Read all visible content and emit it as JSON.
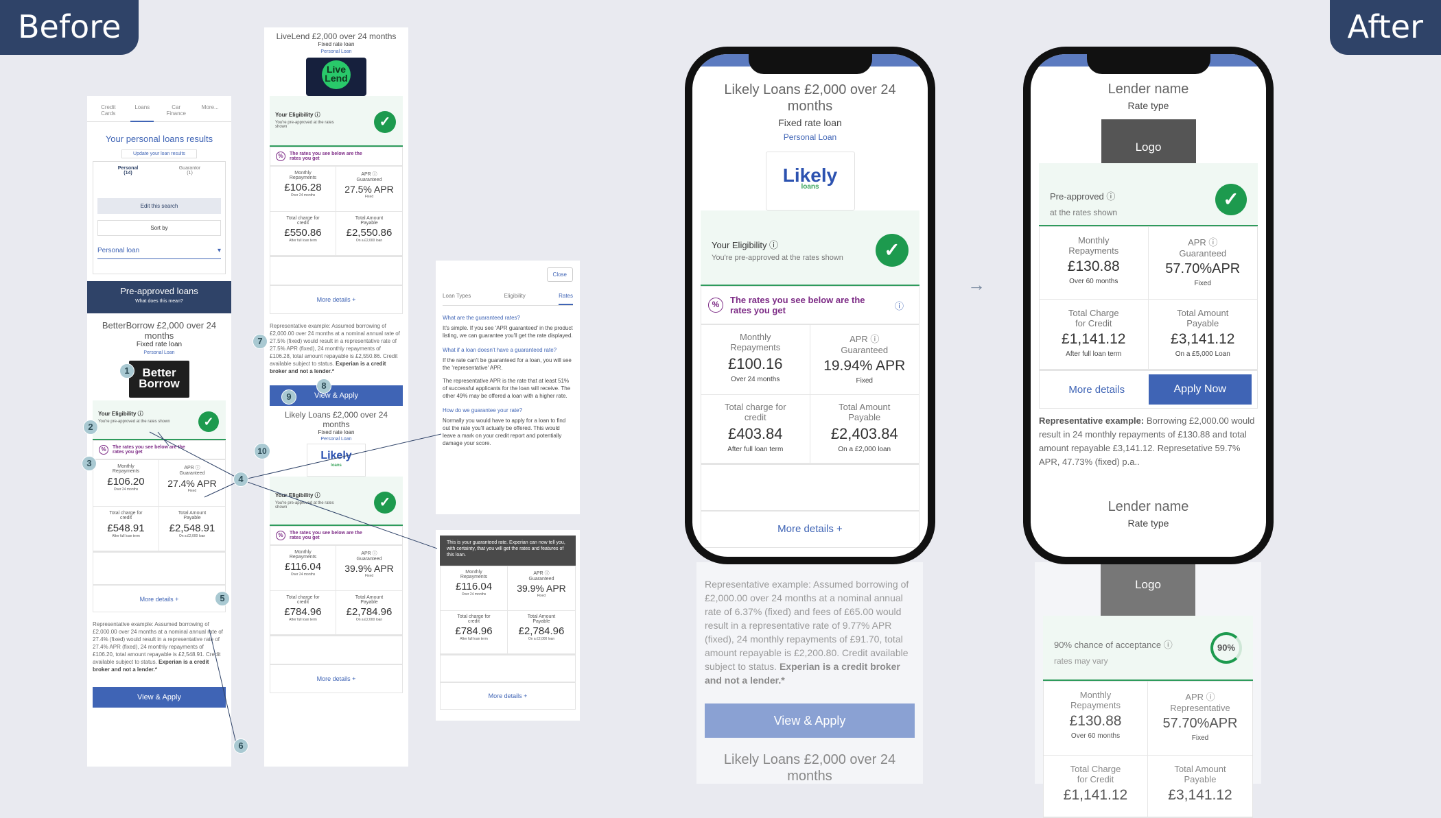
{
  "labels": {
    "before": "Before",
    "after": "After"
  },
  "colors": {
    "accent": "#3f64b5",
    "navy": "#2f4368",
    "green": "#1d9a4e",
    "purple": "#7c2a85",
    "annot": "#a9c9d2"
  },
  "p1": {
    "tabs": [
      "Credit Cards",
      "Loans",
      "Car Finance",
      "More..."
    ],
    "results_title": "Your personal loans results",
    "update_link": "Update your loan results",
    "filter": [
      {
        "label": "Personal",
        "count": "(14)"
      },
      {
        "label": "Guarantor",
        "count": "(1)"
      }
    ],
    "edit_search": "Edit this search",
    "sort_by": "Sort by",
    "loan_type": "Personal loan",
    "banner_title": "Pre-approved loans",
    "banner_sub": "What does this mean?",
    "offer_title": "BetterBorrow £2,000 over 24 months",
    "rate_type": "Fixed rate loan",
    "loan_link": "Personal Loan",
    "logo_text": "Better Borrow",
    "elig_title": "Your Eligibility ⓘ",
    "elig_sub": "You're pre-approved at the rates shown",
    "rates_note": "The rates you see below are the rates you get",
    "cells": [
      {
        "label": "Monthly Repayments",
        "value": "£106.20",
        "sub": "Over 24 months"
      },
      {
        "label": "APR ⓘ Guaranteed",
        "value": "27.4% APR",
        "sub": "Fixed"
      },
      {
        "label": "Total charge for credit",
        "value": "£548.91",
        "sub": "After full loan term"
      },
      {
        "label": "Total Amount Payable",
        "value": "£2,548.91",
        "sub": "On a £2,000 loan"
      }
    ],
    "more": "More details +",
    "rep": "Representative example: Assumed borrowing of £2,000.00 over 24 months at a nominal annual rate of 27.4% (fixed) would result in a representative rate of 27.4% APR (fixed), 24 monthly repayments of £106.20, total amount repayable is £2,548.91. Credit available subject to status.",
    "rep_bold": "Experian is a credit broker and not a lender.*",
    "apply": "View & Apply"
  },
  "p2": {
    "title": "LiveLend £2,000 over 24 months",
    "rate_type": "Fixed rate loan",
    "loan_link": "Personal Loan",
    "logo_text": "Live Lend",
    "elig_title": "Your Eligibility ⓘ",
    "elig_sub": "You're pre-approved at the rates shown",
    "rates_note": "The rates you see below are the rates you get",
    "cells": [
      {
        "label": "Monthly Repayments",
        "value": "£106.28",
        "sub": "Over 24 months"
      },
      {
        "label": "APR ⓘ Guaranteed",
        "value": "27.5% APR",
        "sub": "Fixed"
      },
      {
        "label": "Total charge for credit",
        "value": "£550.86",
        "sub": "After full loan term"
      },
      {
        "label": "Total Amount Payable",
        "value": "£2,550.86",
        "sub": "On a £2,000 loan"
      }
    ],
    "more": "More details +",
    "rep": "Representative example: Assumed borrowing of £2,000.00 over 24 months at a nominal annual rate of 27.5% (fixed) would result in a representative rate of 27.5% APR (fixed), 24 monthly repayments of £106.28, total amount repayable is £2,550.86. Credit available subject to status.",
    "rep_bold": "Experian is a credit broker and not a lender.*",
    "apply": "View & Apply",
    "title2": "Likely Loans £2,000 over 24 months",
    "rate_type2": "Fixed rate loan",
    "loan_link2": "Personal Loan",
    "logo2": "Likely",
    "logo2_sub": "loans",
    "cells2": [
      {
        "label": "Monthly Repayments",
        "value": "£116.04",
        "sub": "Over 24 months"
      },
      {
        "label": "APR ⓘ Guaranteed",
        "value": "39.9% APR",
        "sub": "Fixed"
      },
      {
        "label": "Total charge for credit",
        "value": "£784.96",
        "sub": "After full loan term"
      },
      {
        "label": "Total Amount Payable",
        "value": "£2,784.96",
        "sub": "On a £2,000 loan"
      }
    ],
    "more2": "More details +"
  },
  "p3": {
    "close": "Close",
    "tabs": [
      "Loan Types",
      "Eligibility",
      "Rates"
    ],
    "q1": "What are the guaranteed rates?",
    "a1": "It's simple. If you see 'APR guaranteed' in the product listing, we can guarantee you'll get the rate displayed.",
    "q2": "What if a loan doesn't have a guaranteed rate?",
    "a2": "If the rate can't be guaranteed for a loan, you will see the 'representative' APR.",
    "a2b": "The representative APR is the rate that at least 51% of successful applicants for the loan will receive. The other 49% may be offered a loan with a higher rate.",
    "q3": "How do we guarantee your rate?",
    "a3": "Normally you would have to apply for a loan to find out the rate you'll actually be offered. This would leave a mark on your credit report and potentially damage your score."
  },
  "p4": {
    "tooltip": "This is your guaranteed rate. Experian can now tell you, with certainty, that you will get the rates and features of this loan.",
    "cells": [
      {
        "label": "Monthly Repayments",
        "value": "£116.04",
        "sub": "Over 24 months"
      },
      {
        "label": "APR ⓘ Guaranteed",
        "value": "39.9% APR",
        "sub": "Fixed"
      },
      {
        "label": "Total charge for credit",
        "value": "£784.96",
        "sub": "After full loan term"
      },
      {
        "label": "Total Amount Payable",
        "value": "£2,784.96",
        "sub": "On a £2,000 loan"
      }
    ],
    "more": "More details +"
  },
  "annotations": [
    "1",
    "2",
    "3",
    "4",
    "5",
    "6",
    "7",
    "8",
    "9",
    "10"
  ],
  "phone1": {
    "title": "Likely Loans £2,000 over 24 months",
    "rate_type": "Fixed rate loan",
    "loan_link": "Personal Loan",
    "logo": "Likely",
    "logo_sub": "loans",
    "elig_title": "Your Eligibility ⓘ",
    "elig_sub": "You're pre-approved at the rates shown",
    "rates_note": "The rates you see below are the rates you get",
    "cells": [
      {
        "label": "Monthly Repayments",
        "value": "£100.16",
        "sub": "Over 24 months"
      },
      {
        "label": "APR ⓘ Guaranteed",
        "value": "19.94% APR",
        "sub": "Fixed"
      },
      {
        "label": "Total charge for credit",
        "value": "£403.84",
        "sub": "After full loan term"
      },
      {
        "label": "Total Amount Payable",
        "value": "£2,403.84",
        "sub": "On a £2,000 loan"
      }
    ],
    "more": "More details +",
    "rep": "Representative example: Assumed borrowing of £2,000.00 over 24 months at a nominal annual rate of 6.37% (fixed) and fees of £65.00 would result in a representative rate of 9.77% APR (fixed), 24 monthly repayments of £91.70, total amount repayable is £2,200.80. Credit available subject to status.",
    "rep_bold": "Experian is a credit broker and not a lender.*",
    "apply": "View & Apply",
    "next_title": "Likely Loans £2,000 over 24 months"
  },
  "arrow": "→",
  "phone2": {
    "lender": "Lender name",
    "rate_type": "Rate type",
    "logo": "Logo",
    "pre": "Pre-approved ⓘ",
    "pre_sub": "at the rates shown",
    "cells": [
      {
        "label": "Monthly Repayments",
        "value": "£130.88",
        "sub": "Over 60 months"
      },
      {
        "label": "APR ⓘ Guaranteed",
        "value": "57.70%APR",
        "sub": "Fixed"
      },
      {
        "label": "Total Charge for Credit",
        "value": "£1,141.12",
        "sub": "After full loan term"
      },
      {
        "label": "Total Amount Payable",
        "value": "£3,141.12",
        "sub": "On a £5,000 Loan"
      }
    ],
    "more": "More details",
    "apply": "Apply Now",
    "rep_bold": "Representative example:",
    "rep": "Borrowing £2,000.00 would result in 24 monthly repayments of £130.88 and total amount repayable £3,141.12. Represetative 59.7% APR, 47.73% (fixed) p.a..",
    "lender2": "Lender name",
    "rate_type2": "Rate type",
    "logo2": "Logo",
    "chance": "90% chance of acceptance ⓘ",
    "chance_sub": "rates may vary",
    "chance_pct": "90%",
    "cells2": [
      {
        "label": "Monthly Repayments",
        "value": "£130.88",
        "sub": "Over 60 months"
      },
      {
        "label": "APR ⓘ Representative",
        "value": "57.70%APR",
        "sub": "Fixed"
      },
      {
        "label": "Total Charge for Credit",
        "value": "£1,141.12",
        "sub": ""
      },
      {
        "label": "Total Amount Payable",
        "value": "£3,141.12",
        "sub": ""
      }
    ]
  }
}
